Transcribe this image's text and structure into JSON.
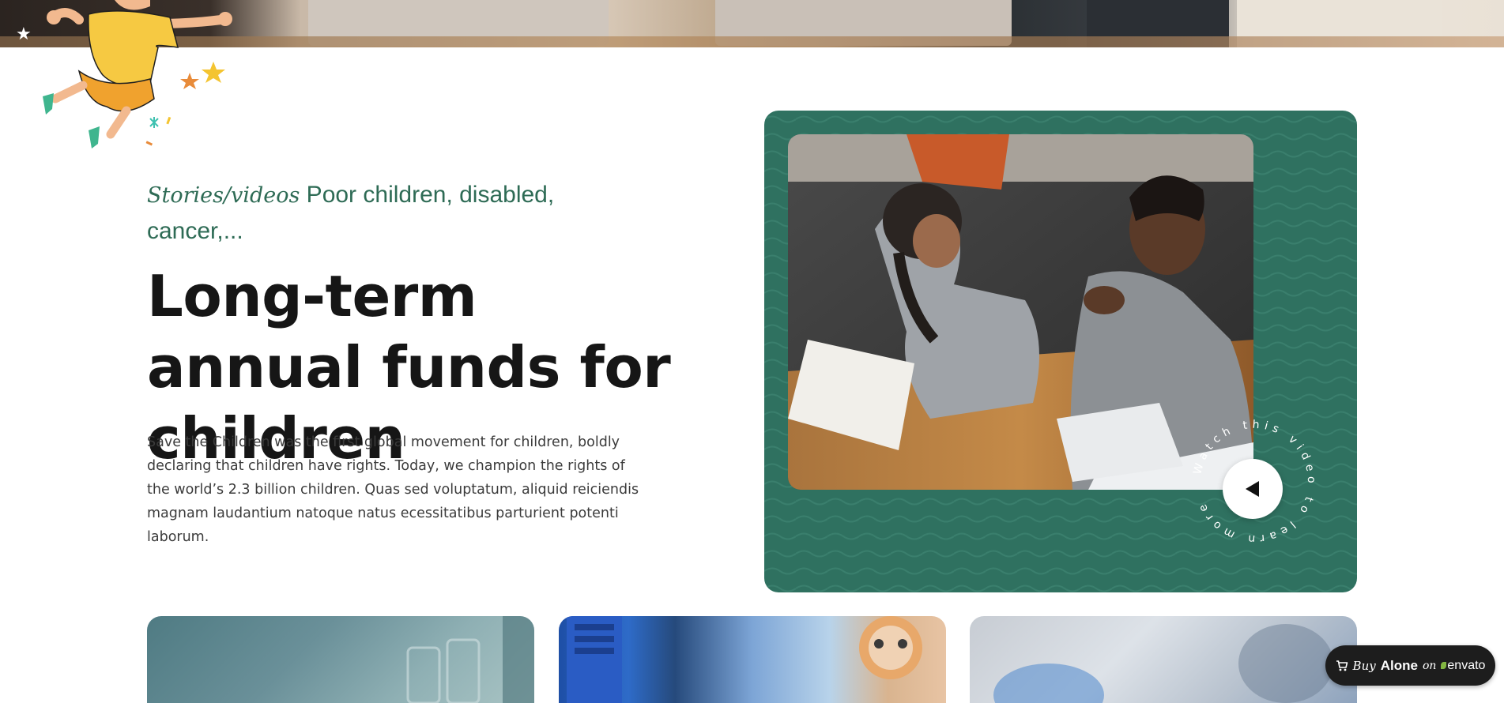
{
  "hero": {
    "eyebrow_italic": "Stories/videos",
    "eyebrow_rest": " Poor children, disabled, cancer,...",
    "headline": "Long-term annual funds for children",
    "body": "Save the Children was the first global movement for children, boldly declaring that children have rights. Today, we champion the rights of the world’s 2.3 billion children. Quas sed voluptatum, aliquid reiciendis magnam laudantium natoque natus ecessitatibus parturient potenti laborum."
  },
  "video": {
    "circular_text": "Watch this video to learn more",
    "play_icon": "play-icon"
  },
  "envato_badge": {
    "cart_icon": "cart-icon",
    "buy": "Buy",
    "alone": "Alone",
    "on": "on",
    "brand": "envato"
  },
  "colors": {
    "accent_green": "#2f7160",
    "eyebrow_green": "#2e6b55",
    "headline": "#161616"
  }
}
